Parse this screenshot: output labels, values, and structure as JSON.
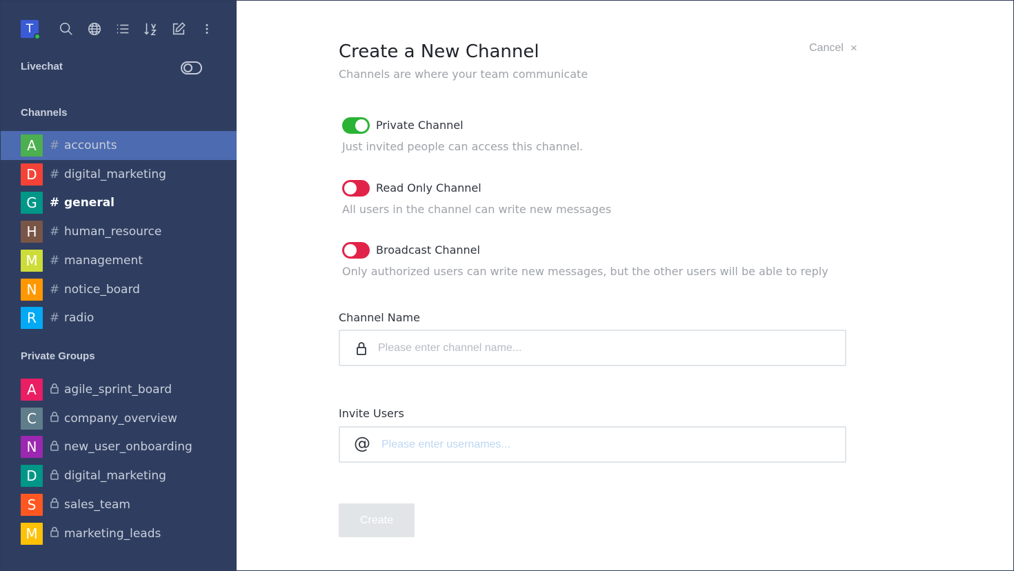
{
  "sidebar": {
    "user_initial": "T",
    "livechat_label": "Livechat",
    "channels_title": "Channels",
    "channels": [
      {
        "initial": "A",
        "name": "accounts",
        "color": "#4caf50"
      },
      {
        "initial": "D",
        "name": "digital_marketing",
        "color": "#f44336"
      },
      {
        "initial": "G",
        "name": "general",
        "color": "#009688"
      },
      {
        "initial": "H",
        "name": "human_resource",
        "color": "#795548"
      },
      {
        "initial": "M",
        "name": "management",
        "color": "#cddc39"
      },
      {
        "initial": "N",
        "name": "notice_board",
        "color": "#ff9800"
      },
      {
        "initial": "R",
        "name": "radio",
        "color": "#03a9f4"
      }
    ],
    "groups_title": "Private Groups",
    "groups": [
      {
        "initial": "A",
        "name": "agile_sprint_board",
        "color": "#e91e63"
      },
      {
        "initial": "C",
        "name": "company_overview",
        "color": "#607d8b"
      },
      {
        "initial": "N",
        "name": "new_user_onboarding",
        "color": "#9c27b0"
      },
      {
        "initial": "D",
        "name": "digital_marketing",
        "color": "#009688"
      },
      {
        "initial": "S",
        "name": "sales_team",
        "color": "#ff5722"
      },
      {
        "initial": "M",
        "name": "marketing_leads",
        "color": "#ffc107"
      }
    ],
    "channel_symbol": "#"
  },
  "form": {
    "title": "Create a New Channel",
    "subtitle": "Channels are where your team communicate",
    "cancel_label": "Cancel",
    "cancel_icon": "×",
    "private": {
      "label": "Private Channel",
      "desc": "Just invited people can access this channel.",
      "on": true
    },
    "readonly": {
      "label": "Read Only Channel",
      "desc": "All users in the channel can write new messages",
      "on": false
    },
    "broadcast": {
      "label": "Broadcast Channel",
      "desc": "Only authorized users can write new messages, but the other users will be able to reply",
      "on": false
    },
    "name_label": "Channel Name",
    "name_placeholder": "Please enter channel name...",
    "users_label": "Invite Users",
    "users_icon": "@",
    "users_placeholder": "Please enter usernames...",
    "create_label": "Create"
  },
  "colors": {
    "sidebar_bg": "#2f3e60",
    "active_room": "#4c6bb0",
    "toggle_on": "#2bb336",
    "toggle_off": "#e1234a"
  }
}
